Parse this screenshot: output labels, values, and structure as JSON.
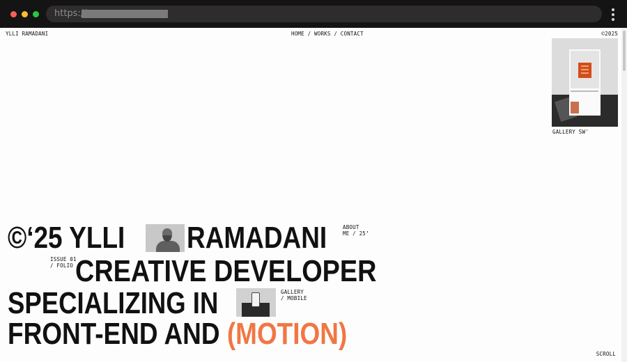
{
  "browser": {
    "url_scheme": "https://"
  },
  "header": {
    "brand": "YLLI RAMADANI",
    "nav": [
      "HOME",
      "WORKS",
      "CONTACT"
    ],
    "nav_sep": "/",
    "year": "©2025"
  },
  "thumbnail": {
    "label": "GALLERY SW'"
  },
  "hero": {
    "line1_left": "©‘25 YLLI",
    "line1_right": "RAMADANI",
    "line2": "CREATIVE DEVELOPER",
    "line3": "SPECIALIZING IN",
    "line4_plain": "FRONT-END AND",
    "line4_accent": "(MOTION)",
    "accent_color": "#f07744"
  },
  "side_labels": {
    "about_1": "ABOUT",
    "about_2": "ME / 25’",
    "issue_1": "ISSUE 01",
    "issue_2": "/ FOLIO",
    "gallery_1": "GALLERY",
    "gallery_2": "/ MOBILE"
  },
  "footer": {
    "scroll": "SCROLL"
  },
  "icons": {
    "window_close": "red-dot",
    "window_minimize": "yellow-dot",
    "window_maximize": "green-dot",
    "menu": "kebab-menu-icon"
  }
}
